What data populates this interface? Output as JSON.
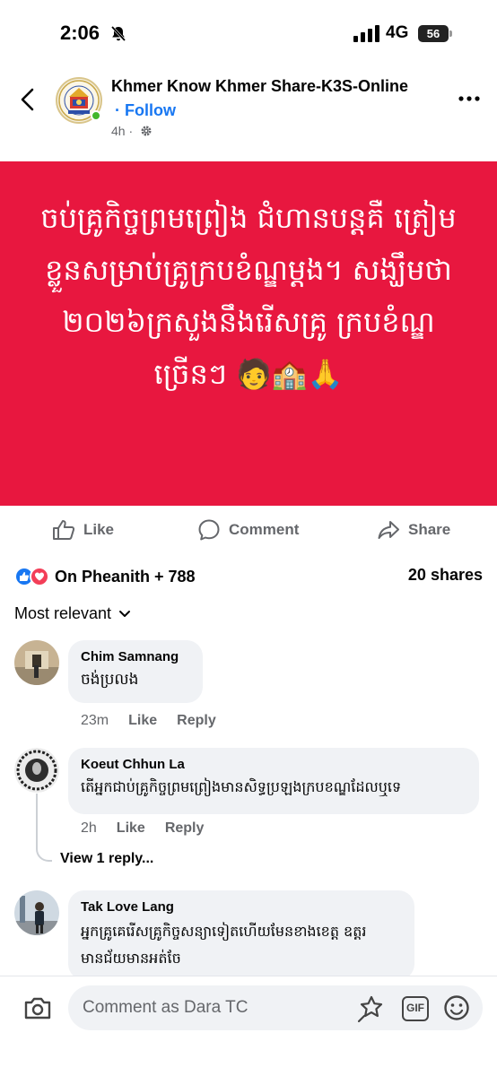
{
  "status_bar": {
    "time": "2:06",
    "network": "4G",
    "battery": "56"
  },
  "post": {
    "page_name": "Khmer Know Khmer Share-K3S-Online",
    "follow_label": "· Follow",
    "time_ago": "4h ·",
    "image_text": "ចប់គ្រូកិច្ចព្រមព្រៀង ជំហានបន្តគឺ ត្រៀមខ្លួនសម្រាប់គ្រូក្របខំណ្ឌម្តង។ សង្ឃឹមថា ២០២៦ក្រសួងនឹងរើសគ្រូ ក្របខំណ្ឌច្រើនៗ 🧑‍🏫🙏",
    "image_bg_color": "#e8173f"
  },
  "actions": {
    "like": "Like",
    "comment": "Comment",
    "share": "Share"
  },
  "reactions": {
    "summary": "On Pheanith + 788",
    "shares": "20 shares"
  },
  "sort": {
    "label": "Most relevant"
  },
  "comments": [
    {
      "name": "Chim Samnang",
      "text": "ចង់ប្រលង",
      "time": "23m",
      "like": "Like",
      "reply": "Reply"
    },
    {
      "name": "Koeut Chhun La",
      "text": "តើអ្នកជាប់គ្រូកិច្ចព្រមព្រៀងមានសិទ្ធប្រឡងក្របខណ្ឌដែលឬទេ",
      "time": "2h",
      "like": "Like",
      "reply": "Reply",
      "view_replies": "View 1 reply..."
    },
    {
      "name": "Tak Love Lang",
      "text": "អ្នកគ្រូគេរើសគ្រូកិច្ចសន្យាទៀតហើយមែនខាងខេត្ត ឧត្តរមានជ័យមានអត់ចែ"
    }
  ],
  "composer": {
    "placeholder": "Comment as Dara TC",
    "gif_label": "GIF"
  },
  "colors": {
    "accent": "#1877f2",
    "online": "#42b72a",
    "love": "#f33e58"
  }
}
